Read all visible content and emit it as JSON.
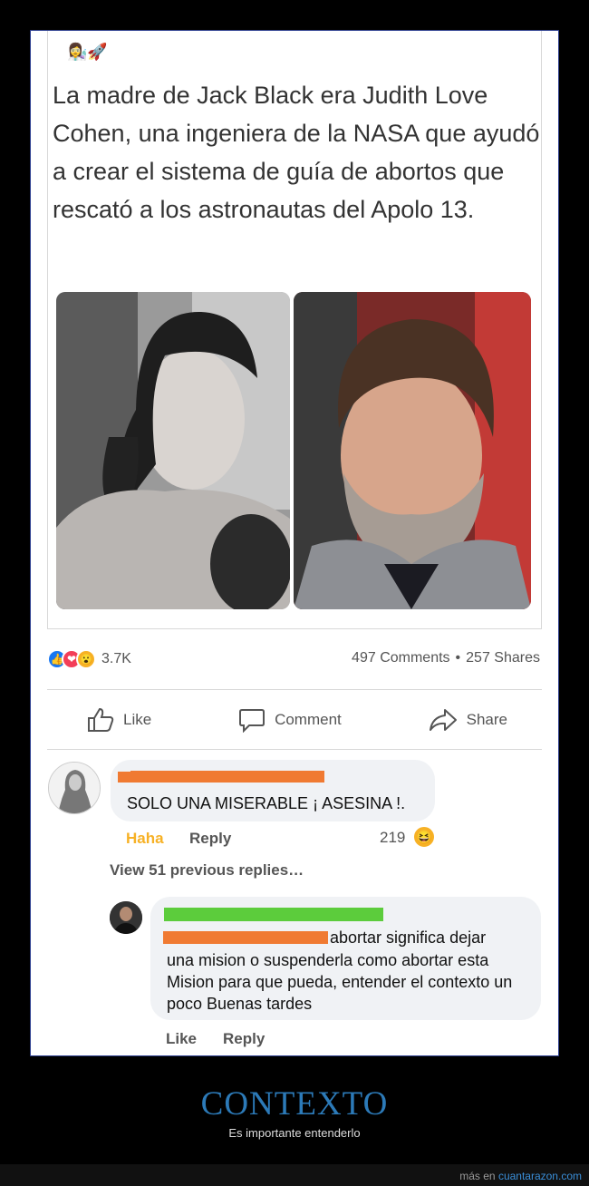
{
  "post": {
    "emoji_line": "👩‍🔬🚀",
    "text": "La madre de Jack Black era Judith Love Cohen, una ingeniera de la NASA que ayudó a crear el sistema de guía de abortos que rescató a los astronautas del Apolo 13."
  },
  "reactions": {
    "icons": [
      "like-reaction-icon",
      "love-reaction-icon",
      "wow-reaction-icon"
    ],
    "count": "3.7K",
    "comments": "497 Comments",
    "separator": "•",
    "shares": "257 Shares"
  },
  "actions": {
    "like": "Like",
    "comment": "Comment",
    "share": "Share"
  },
  "comment1": {
    "text": "SOLO UNA MISERABLE ¡ ASESINA !.",
    "haha": "Haha",
    "reply": "Reply",
    "count": "219",
    "view_replies": "View 51 previous replies…"
  },
  "reply1": {
    "text_first": "abortar significa dejar",
    "text_rest": "una mision o suspenderla como abortar esta Mision para que pueda, entender el contexto un poco Buenas tardes",
    "like": "Like",
    "reply": "Reply"
  },
  "footer": {
    "title": "CONTEXTO",
    "subtitle": "Es importante entenderlo",
    "credit_prefix": "más en",
    "credit_link": "cuantarazon.com"
  },
  "colors": {
    "like_blue": "#1877f2",
    "love_red": "#f33e58",
    "wow_yellow": "#f7b125",
    "redact_orange": "#f07a32",
    "redact_green": "#5ccc3c",
    "title_blue": "#2c7ab8"
  }
}
